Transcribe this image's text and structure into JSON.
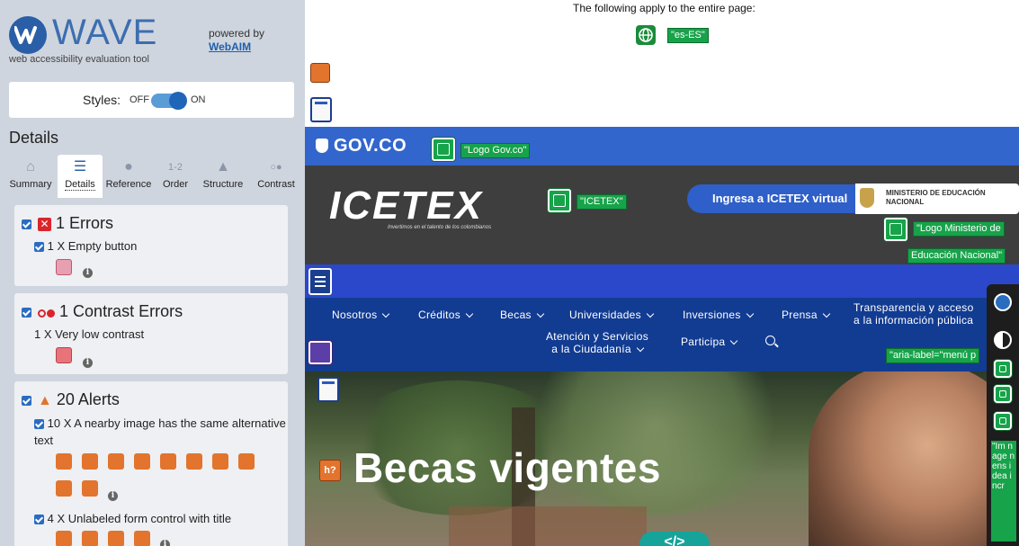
{
  "wave": {
    "brand": "WAVE",
    "tagline": "web accessibility evaluation tool",
    "powered_by": "powered by",
    "webaim": "WebAIM",
    "styles_label": "Styles:",
    "off": "OFF",
    "on": "ON",
    "section_heading": "Details",
    "tabs": [
      {
        "label": "Summary",
        "icon": "home-icon"
      },
      {
        "label": "Details",
        "icon": "list-icon"
      },
      {
        "label": "Reference",
        "icon": "info-icon"
      },
      {
        "label": "Order",
        "icon": "order-icon"
      },
      {
        "label": "Structure",
        "icon": "structure-icon"
      },
      {
        "label": "Contrast",
        "icon": "contrast-icon"
      }
    ],
    "errors": {
      "heading": "1 Errors",
      "item": "1 X Empty button"
    },
    "contrast": {
      "heading": "1 Contrast Errors",
      "item": "1 X Very low contrast"
    },
    "alerts": {
      "heading": "20 Alerts",
      "item1": "10 X A nearby image has the same alternative text",
      "item2": "4 X Unlabeled form control with title"
    },
    "colors": {
      "error": "#d9262c",
      "alert": "#e2742d",
      "accent": "#2a6cc0"
    }
  },
  "page": {
    "apply_text": "The following apply to the entire page:",
    "lang_tag": "\"es-ES\"",
    "gov_text": "GOV.CO",
    "gov_logo_tag": "\"Logo Gov.co\"",
    "icetex_logo": "ICETEX",
    "icetex_tagline": "Invertimos en el talento de los colombianos",
    "icetex_tag": "\"ICETEX\"",
    "ingresa": "Ingresa a ICETEX virtual",
    "ministerio": "MINISTERIO DE EDUCACIÓN NACIONAL",
    "ministerio_tag_1": "\"Logo Ministerio de",
    "ministerio_tag_2": "Educación Nacional\"",
    "nav": {
      "nosotros": "Nosotros",
      "creditos": "Créditos",
      "becas": "Becas",
      "universidades": "Universidades",
      "inversiones": "Inversiones",
      "prensa": "Prensa",
      "transparencia_1": "Transparencia y acceso",
      "transparencia_2": "a la información pública",
      "atencion_1": "Atención y Servicios",
      "atencion_2": "a la Ciudadanía",
      "participa": "Participa"
    },
    "aria_tag": "\"aria-label=\"menú p",
    "hero_title": "Becas vigentes",
    "code_badge": "</>",
    "rail_tag": "\"Im n age n ens idea incr"
  }
}
